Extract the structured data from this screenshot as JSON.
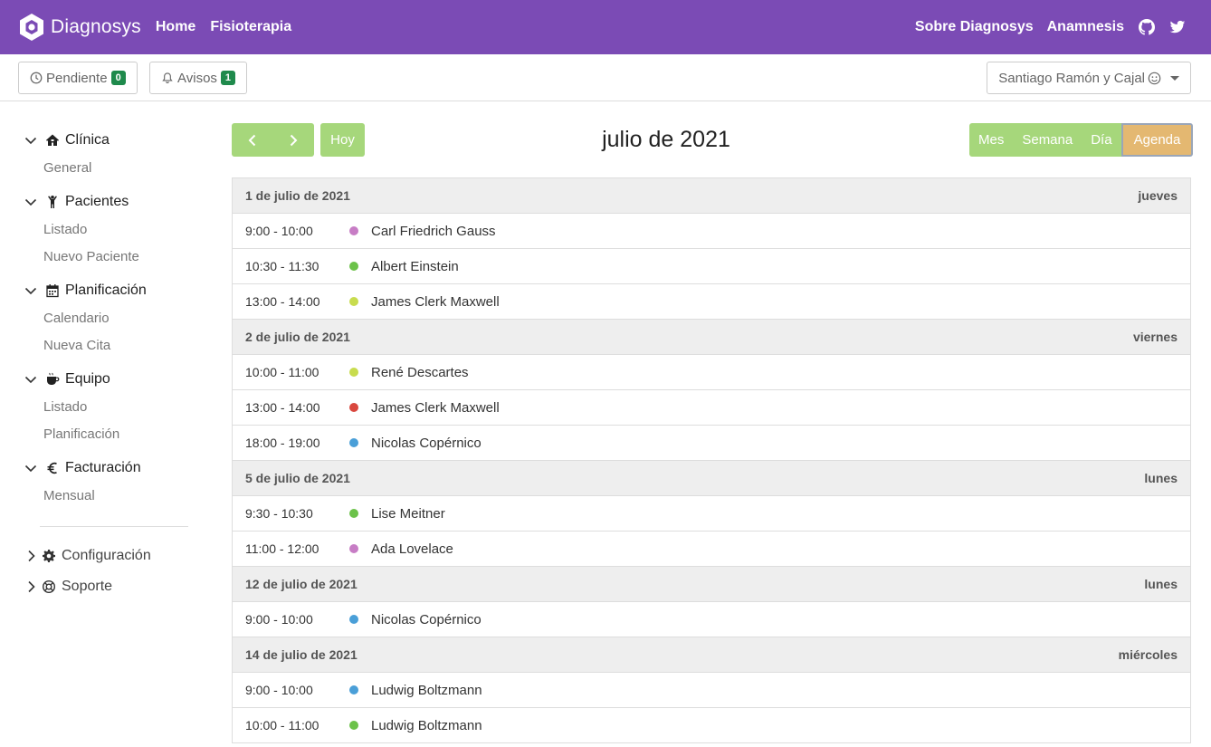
{
  "navbar": {
    "brand": "Diagnosys",
    "links": [
      "Home",
      "Fisioterapia"
    ],
    "right_links": [
      "Sobre Diagnosys",
      "Anamnesis"
    ],
    "bg_color": "#7b4bb5"
  },
  "subbar": {
    "pending": {
      "label": "Pendiente",
      "count": "0"
    },
    "alerts": {
      "label": "Avisos",
      "count": "1"
    },
    "user": "Santiago Ramón y Cajal"
  },
  "sidebar": {
    "sections": [
      {
        "label": "Clínica",
        "icon": "home-icon",
        "items": [
          "General"
        ]
      },
      {
        "label": "Pacientes",
        "icon": "person-icon",
        "items": [
          "Listado",
          "Nuevo Paciente"
        ]
      },
      {
        "label": "Planificación",
        "icon": "calendar-icon",
        "items": [
          "Calendario",
          "Nueva Cita"
        ]
      },
      {
        "label": "Equipo",
        "icon": "coffee-icon",
        "items": [
          "Listado",
          "Planificación"
        ]
      },
      {
        "label": "Facturación",
        "icon": "euro-icon",
        "items": [
          "Mensual"
        ]
      }
    ],
    "bottom": [
      {
        "label": "Configuración",
        "icon": "gear-icon"
      },
      {
        "label": "Soporte",
        "icon": "lifebuoy-icon"
      }
    ]
  },
  "toolbar": {
    "today": "Hoy",
    "title": "julio de 2021",
    "views": [
      "Mes",
      "Semana",
      "Día",
      "Agenda"
    ],
    "active_view": "Agenda",
    "accent": "#a6d77b",
    "active_color": "#e4b871"
  },
  "agenda": [
    {
      "date": "1 de julio de 2021",
      "weekday": "jueves",
      "events": [
        {
          "time": "9:00 - 10:00",
          "name": "Carl Friedrich Gauss",
          "color": "#c77dc5"
        },
        {
          "time": "10:30 - 11:30",
          "name": "Albert Einstein",
          "color": "#6cc24a"
        },
        {
          "time": "13:00 - 14:00",
          "name": "James Clerk Maxwell",
          "color": "#c8dc4e"
        }
      ]
    },
    {
      "date": "2 de julio de 2021",
      "weekday": "viernes",
      "events": [
        {
          "time": "10:00 - 11:00",
          "name": "René Descartes",
          "color": "#c8dc4e"
        },
        {
          "time": "13:00 - 14:00",
          "name": "James Clerk Maxwell",
          "color": "#d9473e"
        },
        {
          "time": "18:00 - 19:00",
          "name": "Nicolas Copérnico",
          "color": "#4a9fd8"
        }
      ]
    },
    {
      "date": "5 de julio de 2021",
      "weekday": "lunes",
      "events": [
        {
          "time": "9:30 - 10:30",
          "name": "Lise Meitner",
          "color": "#6cc24a"
        },
        {
          "time": "11:00 - 12:00",
          "name": "Ada Lovelace",
          "color": "#c77dc5"
        }
      ]
    },
    {
      "date": "12 de julio de 2021",
      "weekday": "lunes",
      "events": [
        {
          "time": "9:00 - 10:00",
          "name": "Nicolas Copérnico",
          "color": "#4a9fd8"
        }
      ]
    },
    {
      "date": "14 de julio de 2021",
      "weekday": "miércoles",
      "events": [
        {
          "time": "9:00 - 10:00",
          "name": "Ludwig Boltzmann",
          "color": "#4a9fd8"
        },
        {
          "time": "10:00 - 11:00",
          "name": "Ludwig Boltzmann",
          "color": "#6cc24a"
        }
      ]
    }
  ]
}
